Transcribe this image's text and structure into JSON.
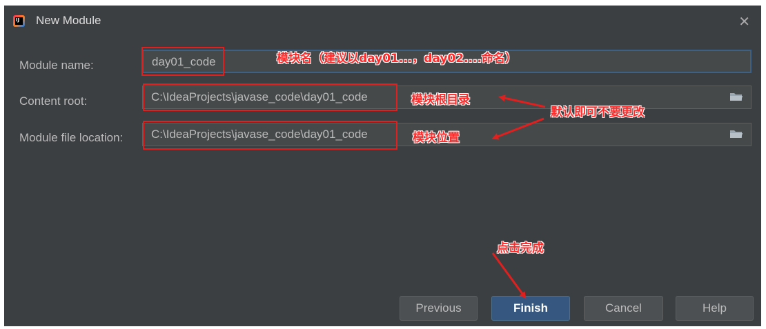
{
  "window": {
    "title": "New Module",
    "app_icon_text": "IJ"
  },
  "form": {
    "module_name": {
      "label": "Module name:",
      "value": "day01_code"
    },
    "content_root": {
      "label": "Content root:",
      "value": "C:\\IdeaProjects\\javase_code\\day01_code"
    },
    "module_file_location": {
      "label": "Module file location:",
      "value": "C:\\IdeaProjects\\javase_code\\day01_code"
    }
  },
  "buttons": {
    "previous": "Previous",
    "finish": "Finish",
    "cancel": "Cancel",
    "help": "Help"
  },
  "annotations": {
    "module_name_note": "模块名（建议以day01...，day02....命名）",
    "content_root_note": "模块根目录",
    "default_note": "默认即可不要更改",
    "location_note": "模块位置",
    "finish_note": "点击完成"
  },
  "colors": {
    "background": "#3c3f41",
    "annotation": "#ff2a2a",
    "primary_button": "#365880"
  }
}
